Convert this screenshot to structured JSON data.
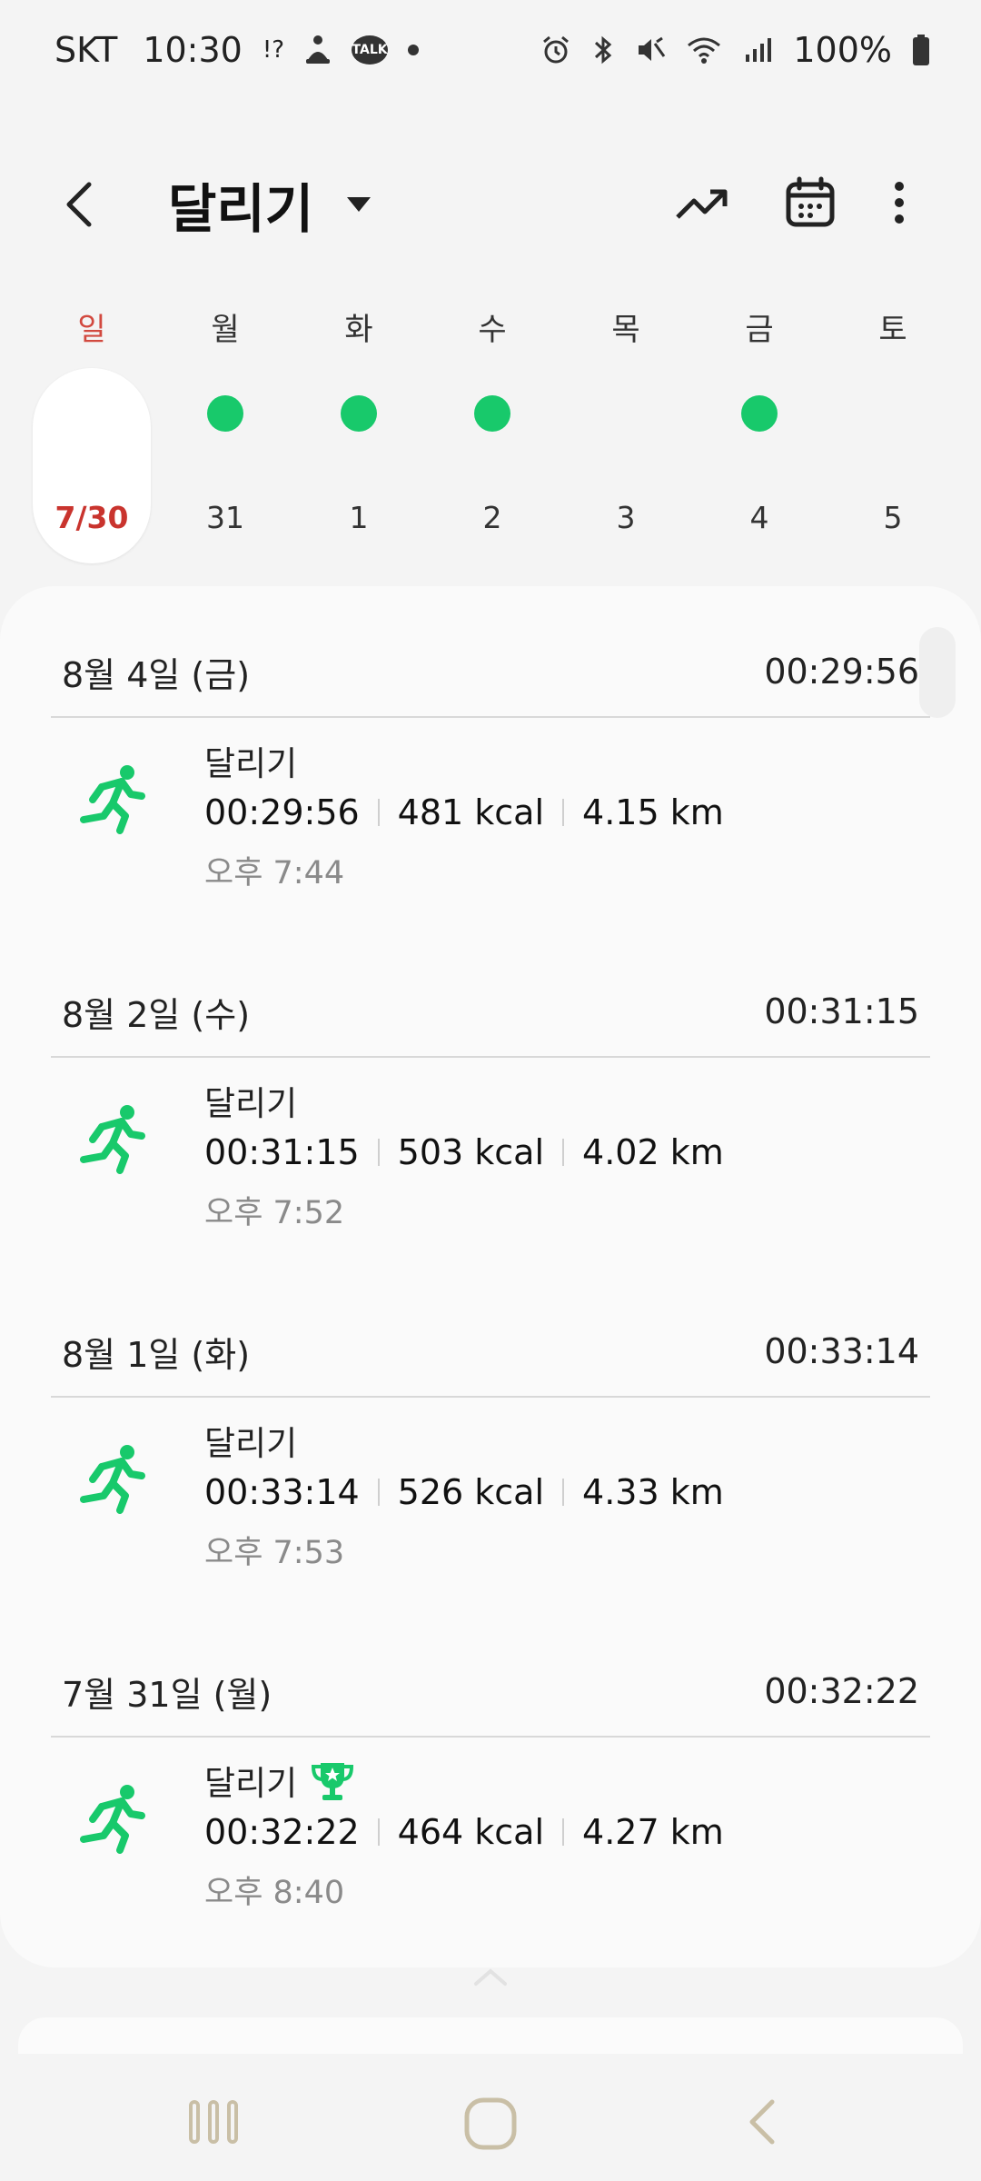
{
  "status_bar": {
    "carrier": "SKT",
    "time": "10:30",
    "battery": "100%"
  },
  "header": {
    "title": "달리기"
  },
  "week": {
    "days": [
      {
        "name": "일",
        "date": "7/30",
        "has_record": false,
        "selected": true
      },
      {
        "name": "월",
        "date": "31",
        "has_record": true,
        "selected": false
      },
      {
        "name": "화",
        "date": "1",
        "has_record": true,
        "selected": false
      },
      {
        "name": "수",
        "date": "2",
        "has_record": true,
        "selected": false
      },
      {
        "name": "목",
        "date": "3",
        "has_record": false,
        "selected": false
      },
      {
        "name": "금",
        "date": "4",
        "has_record": true,
        "selected": false
      },
      {
        "name": "토",
        "date": "5",
        "has_record": false,
        "selected": false
      }
    ]
  },
  "records": [
    {
      "date": "8월 4일 (금)",
      "total": "00:29:56",
      "type": "달리기",
      "duration": "00:29:56",
      "calories": "481 kcal",
      "distance": "4.15 km",
      "start": "오후 7:44",
      "trophy": false
    },
    {
      "date": "8월 2일 (수)",
      "total": "00:31:15",
      "type": "달리기",
      "duration": "00:31:15",
      "calories": "503 kcal",
      "distance": "4.02 km",
      "start": "오후 7:52",
      "trophy": false
    },
    {
      "date": "8월 1일 (화)",
      "total": "00:33:14",
      "type": "달리기",
      "duration": "00:33:14",
      "calories": "526 kcal",
      "distance": "4.33 km",
      "start": "오후 7:53",
      "trophy": false
    },
    {
      "date": "7월 31일 (월)",
      "total": "00:32:22",
      "type": "달리기",
      "duration": "00:32:22",
      "calories": "464 kcal",
      "distance": "4.27 km",
      "start": "오후 8:40",
      "trophy": true
    }
  ],
  "colors": {
    "accent_green": "#18c96b",
    "sunday_red": "#c9342e"
  },
  "icons": [
    "back-icon",
    "dropdown-icon",
    "trend-icon",
    "calendar-icon",
    "more-icon",
    "running-icon",
    "trophy-icon"
  ]
}
